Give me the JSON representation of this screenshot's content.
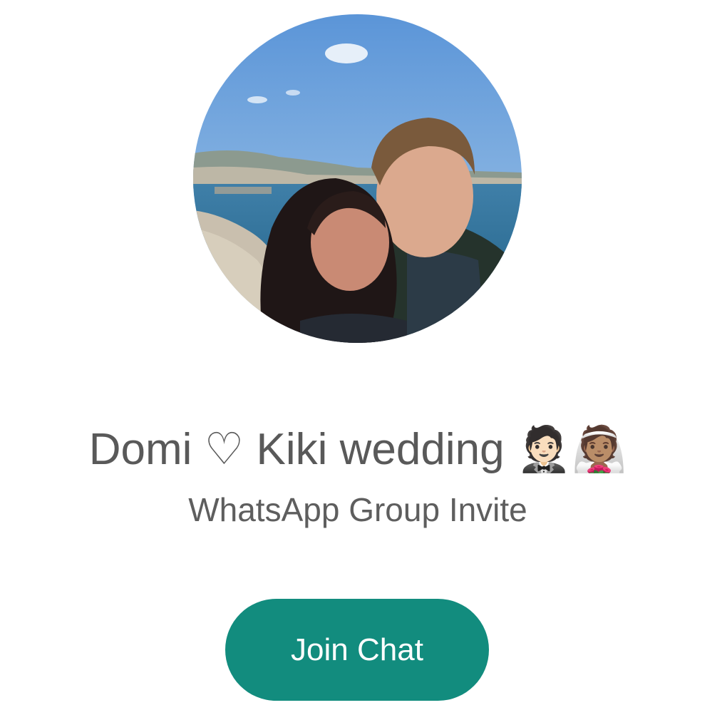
{
  "invite": {
    "group_name": "Domi ♡ Kiki wedding 🤵🏻👰🏽",
    "subtitle": "WhatsApp Group Invite",
    "join_label": "Join Chat"
  },
  "colors": {
    "button": "#128c7e",
    "title_text": "#595959",
    "subtitle_text": "#5e5e5e"
  }
}
